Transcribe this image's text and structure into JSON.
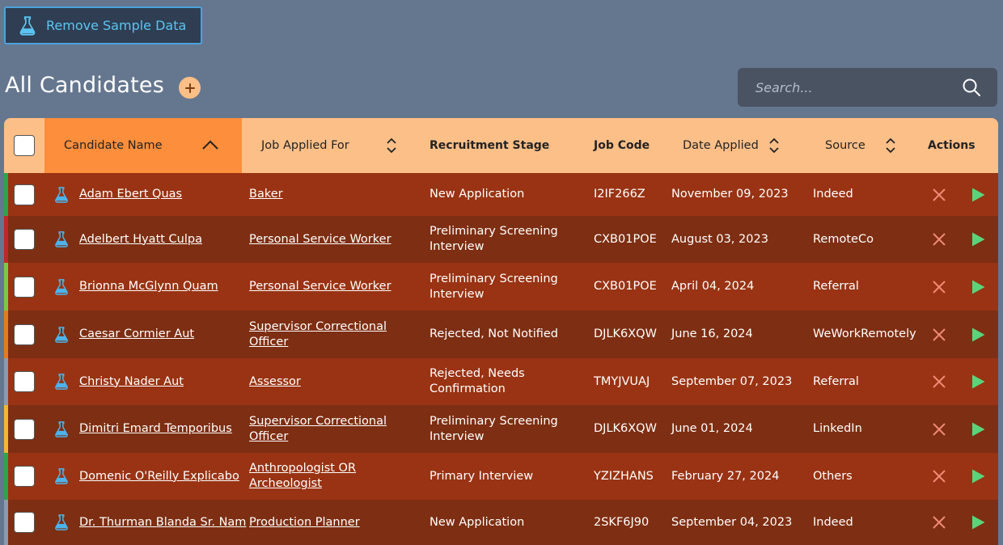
{
  "toolbar": {
    "remove_sample_label": "Remove Sample Data"
  },
  "page": {
    "title": "All Candidates"
  },
  "search": {
    "placeholder": "Search..."
  },
  "colors": {
    "accent": "#fdbf88",
    "sorted_header": "#fd8e3b",
    "row_odd": "#993313",
    "row_even": "#7e2e12",
    "flask": "#4cb3ec",
    "reject": "#f08a75",
    "advance": "#5ad47b"
  },
  "table": {
    "headers": {
      "name": "Candidate Name",
      "job": "Job Applied For",
      "stage": "Recruitment Stage",
      "code": "Job Code",
      "date": "Date Applied",
      "source": "Source",
      "actions": "Actions"
    },
    "rows": [
      {
        "name": "Adam Ebert Quas",
        "job": [
          "Baker"
        ],
        "stage": [
          "New Application"
        ],
        "code": "I2IF266Z",
        "date": "November 09, 2023",
        "source": "Indeed",
        "stripe": "#2ea44f"
      },
      {
        "name": "Adelbert Hyatt Culpa",
        "job": [
          "Personal Service Worker"
        ],
        "stage": [
          "Preliminary Screening",
          "Interview"
        ],
        "code": "CXB01POE",
        "date": "August 03, 2023",
        "source": "RemoteCo",
        "stripe": "#c0282d"
      },
      {
        "name": "Brionna McGlynn Quam",
        "job": [
          "Personal Service Worker"
        ],
        "stage": [
          "Preliminary Screening",
          "Interview"
        ],
        "code": "CXB01POE",
        "date": "April 04, 2024",
        "source": "Referral",
        "stripe": "#7ac943"
      },
      {
        "name": "Caesar Cormier Aut",
        "job": [
          "Supervisor Correctional",
          "Officer"
        ],
        "stage": [
          "Rejected, Not Notified"
        ],
        "code": "DJLK6XQW",
        "date": "June 16, 2024",
        "source": "WeWorkRemotely",
        "stripe": "#e57b1f"
      },
      {
        "name": "Christy Nader Aut",
        "job": [
          "Assessor"
        ],
        "stage": [
          "Rejected, Needs",
          "Confirmation"
        ],
        "code": "TMYJVUAJ",
        "date": "September 07, 2023",
        "source": "Referral",
        "stripe": "#8a9ab0"
      },
      {
        "name": "Dimitri Emard Temporibus",
        "job": [
          "Supervisor Correctional",
          "Officer"
        ],
        "stage": [
          "Preliminary Screening",
          "Interview"
        ],
        "code": "DJLK6XQW",
        "date": "June 01, 2024",
        "source": "LinkedIn",
        "stripe": "#f2b632"
      },
      {
        "name": "Domenic O'Reilly Explicabo",
        "job": [
          "Anthropologist OR",
          "Archeologist"
        ],
        "stage": [
          "Primary Interview"
        ],
        "code": "YZIZHANS",
        "date": "February 27, 2024",
        "source": "Others",
        "stripe": "#2ea44f"
      },
      {
        "name": "Dr. Thurman Blanda Sr. Nam",
        "job": [
          "Production Planner"
        ],
        "stage": [
          "New Application"
        ],
        "code": "2SKF6J90",
        "date": "September 04, 2023",
        "source": "Indeed",
        "stripe": "#8a9ab0"
      }
    ]
  }
}
